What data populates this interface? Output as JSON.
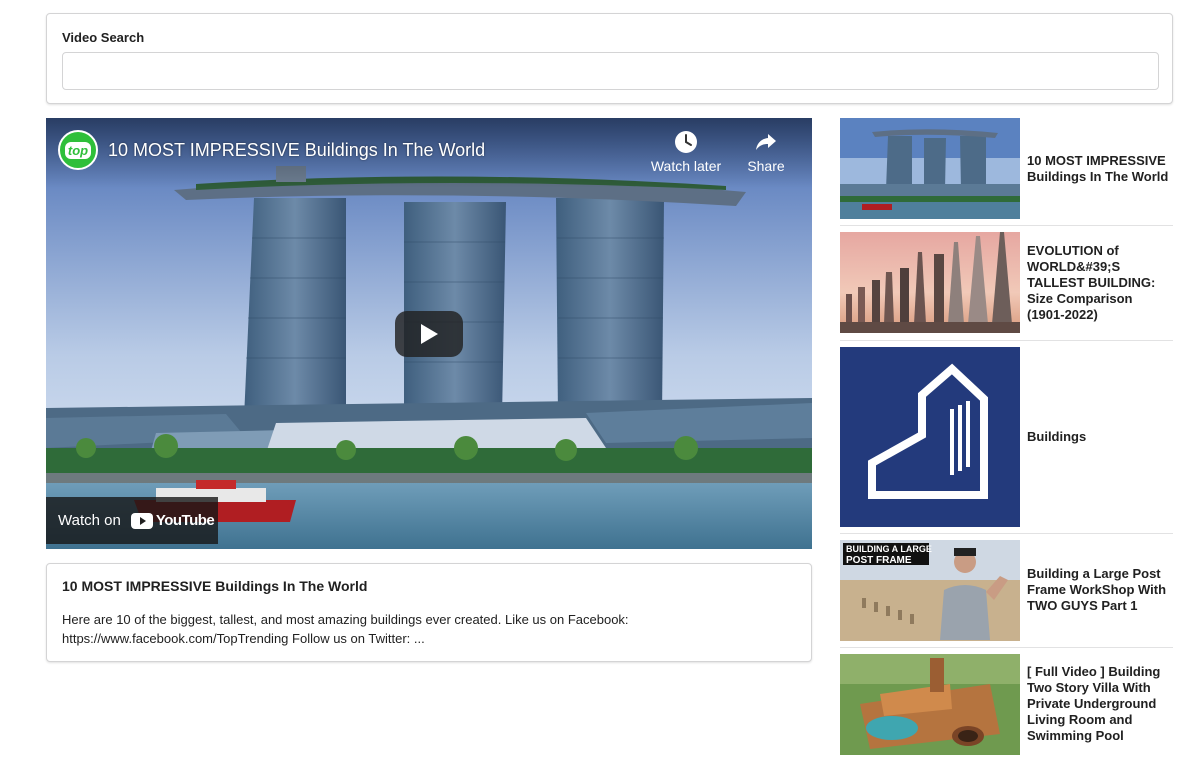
{
  "search": {
    "label": "Video Search",
    "value": "",
    "placeholder": ""
  },
  "player": {
    "channel_logo_text": "top",
    "title": "10 MOST IMPRESSIVE Buildings In The World",
    "watch_later_label": "Watch later",
    "share_label": "Share",
    "watch_on_label": "Watch on",
    "youtube_label": "YouTube"
  },
  "selected_video": {
    "title": "10 MOST IMPRESSIVE Buildings In The World",
    "description": "Here are 10 of the biggest, tallest, and most amazing buildings ever created. Like us on Facebook: https://www.facebook.com/TopTrending Follow us on Twitter: ..."
  },
  "video_list": [
    {
      "title": "10 MOST IMPRESSIVE Buildings In The World",
      "thumb": "marina-bay-sands"
    },
    {
      "title": "EVOLUTION of WORLD&#39;S TALLEST BUILDING: Size Comparison (1901-2022)",
      "thumb": "skyscraper-comparison"
    },
    {
      "title": "Buildings",
      "thumb": "building-logo"
    },
    {
      "title": "Building a Large Post Frame WorkShop With TWO GUYS Part 1",
      "thumb": "post-frame-man",
      "thumb_text": [
        "BUILDING A LARGE",
        "POST FRAME"
      ]
    },
    {
      "title": "[ Full Video ] Building Two Story Villa With Private Underground Living Room and Swimming Pool",
      "thumb": "villa-pool"
    }
  ],
  "colors": {
    "border": "#d4d4d5",
    "text": "#212121",
    "logo_blue": "#233a7c",
    "channel_green": "#2fbf3a"
  }
}
